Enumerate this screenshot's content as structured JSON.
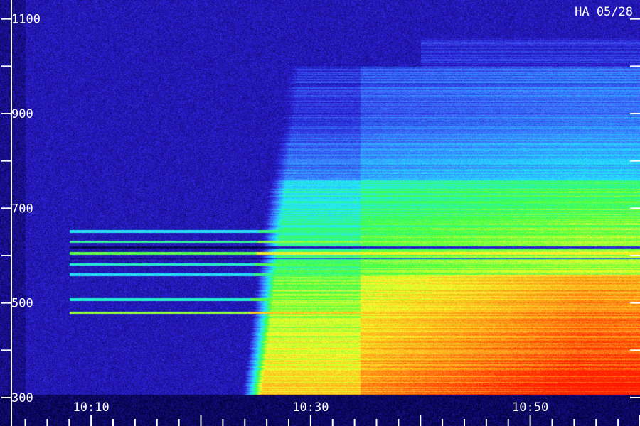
{
  "chart_data": {
    "type": "heatmap",
    "title": "HA 05/28",
    "xlabel": "",
    "ylabel": "",
    "x_ticks": [
      {
        "label": "10:10",
        "minutes": 0
      },
      {
        "label": "10:30",
        "minutes": 20
      },
      {
        "label": "10:50",
        "minutes": 40
      }
    ],
    "xlim_minutes": [
      -8.3,
      50
    ],
    "y_ticks": [
      {
        "label": "1100",
        "value": 1100
      },
      {
        "label": "900",
        "value": 900
      },
      {
        "label": "700",
        "value": 700
      },
      {
        "label": "500",
        "value": 500
      },
      {
        "label": "300",
        "value": 300
      }
    ],
    "ylim": [
      240,
      1140
    ],
    "colormap": [
      "#000033",
      "#2a1bd0",
      "#3b7bff",
      "#22e8ff",
      "#3cff4a",
      "#f5ff2a",
      "#ff9c1a",
      "#ff1a00"
    ],
    "burst_onset_minutes": 13.5,
    "burst_step_minutes": 24.5,
    "narrowband_lines": [
      {
        "value": 652,
        "intensity": 0.5
      },
      {
        "value": 630,
        "intensity": 0.6
      },
      {
        "value": 605,
        "intensity": 0.7
      },
      {
        "value": 582,
        "intensity": 0.55
      },
      {
        "value": 560,
        "intensity": 0.5
      },
      {
        "value": 508,
        "intensity": 0.55
      },
      {
        "value": 480,
        "intensity": 0.75
      }
    ]
  }
}
